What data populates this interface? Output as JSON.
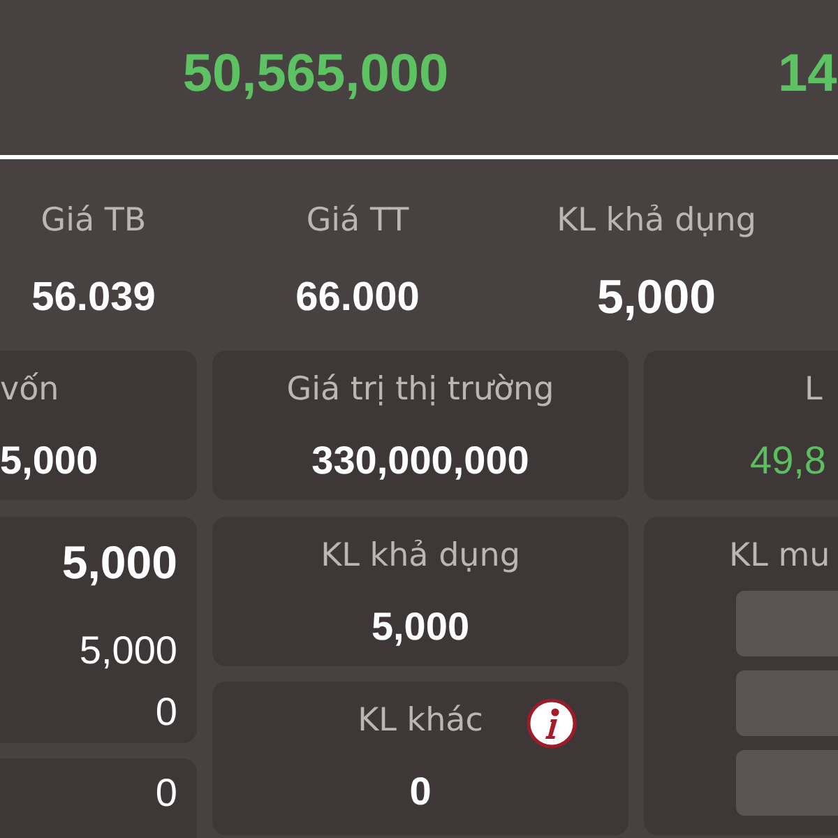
{
  "summary": [
    {
      "value": "50,565,000",
      "positive": true
    },
    {
      "value": "14",
      "positive": true
    }
  ],
  "stats": [
    {
      "label": "Giá TB",
      "value": "56.039",
      "emphasized": false
    },
    {
      "label": "Giá TT",
      "value": "66.000",
      "emphasized": false
    },
    {
      "label": "KL khả dụng",
      "value": "5,000",
      "emphasized": true
    }
  ],
  "value_cards": [
    {
      "label": "vốn",
      "value": "5,000",
      "positive": false
    },
    {
      "label": "Giá trị thị trường",
      "value": "330,000,000",
      "positive": false
    },
    {
      "label": "L",
      "value": "49,8",
      "positive": true
    }
  ],
  "volume_cards": {
    "left": [
      {
        "rows": [
          {
            "kind": "total",
            "value": "5,000"
          },
          {
            "kind": "line",
            "value": "5,000"
          },
          {
            "kind": "line",
            "value": "0"
          }
        ]
      },
      {
        "rows": [
          {
            "kind": "line",
            "value": "0"
          }
        ]
      }
    ],
    "middle": [
      {
        "label": "KL khả dụng",
        "value": "5,000",
        "info": false
      },
      {
        "label": "KL khác",
        "value": "0",
        "info": true
      }
    ],
    "right": [
      {
        "label": "KL mu",
        "inputs": [
          {
            "kind": "field"
          },
          {
            "kind": "field"
          },
          {
            "kind": "field"
          }
        ]
      }
    ]
  }
}
